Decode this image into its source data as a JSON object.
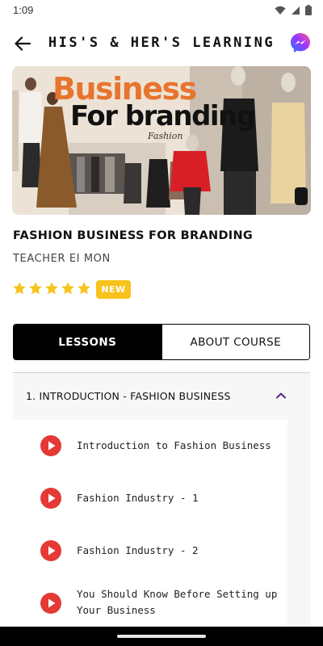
{
  "status_bar": {
    "time": "1:09"
  },
  "app_bar": {
    "title": "HIS'S & HER'S LEARNING"
  },
  "hero": {
    "line1": "Business",
    "line2": "For branding",
    "script": "Fashion"
  },
  "course": {
    "title": "FASHION BUSINESS FOR BRANDING",
    "teacher": "TEACHER EI MON",
    "rating": 5,
    "badge": "NEW"
  },
  "tabs": [
    {
      "label": "LESSONS",
      "active": true
    },
    {
      "label": "ABOUT COURSE",
      "active": false
    }
  ],
  "section": {
    "title": "1. INTRODUCTION - FASHION BUSINESS"
  },
  "lessons": [
    {
      "label": "Introduction to Fashion Business"
    },
    {
      "label": "Fashion Industry - 1"
    },
    {
      "label": "Fashion Industry - 2"
    },
    {
      "label": "You Should Know Before Setting up Your Business"
    }
  ],
  "colors": {
    "accent_red": "#e53935",
    "badge_yellow": "#f7c21a",
    "chevron_purple": "#5b2a86"
  }
}
